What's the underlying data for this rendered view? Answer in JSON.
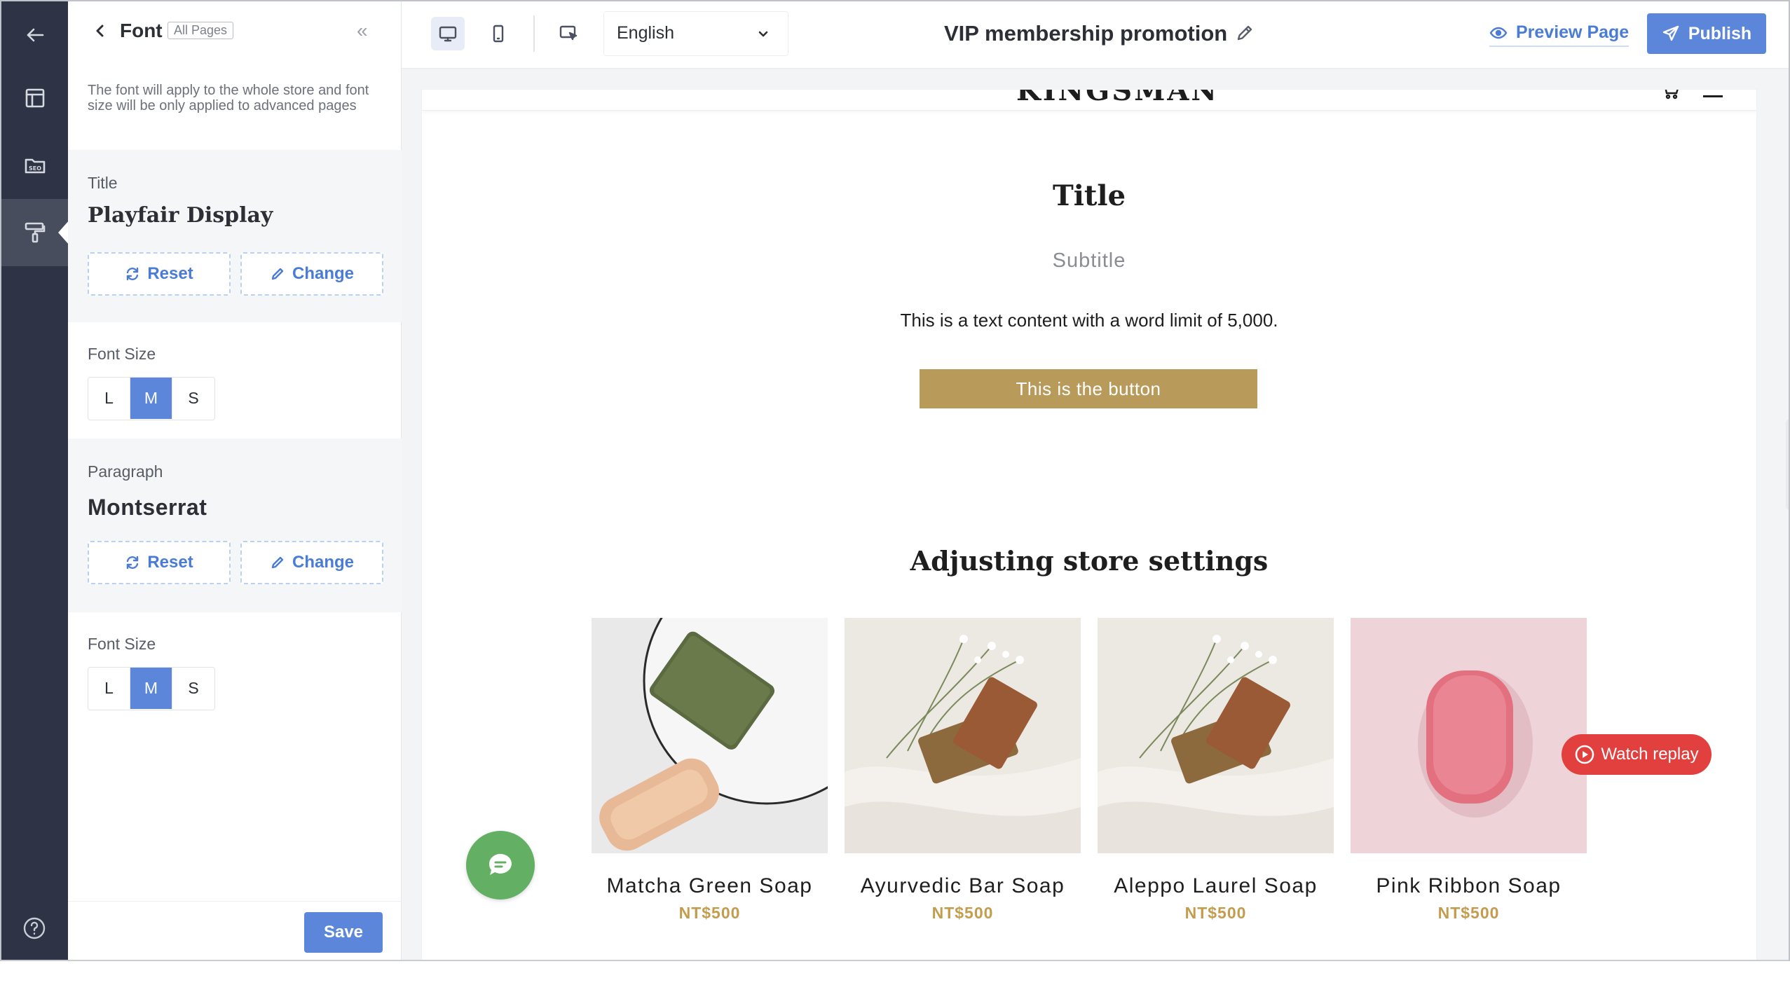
{
  "rail": {
    "items": [
      {
        "icon": "arrow-left-icon"
      },
      {
        "icon": "layout-icon"
      },
      {
        "icon": "seo-icon"
      },
      {
        "icon": "paint-roller-icon"
      }
    ],
    "help_icon": "help-circle-icon"
  },
  "panel": {
    "title": "Font",
    "badge": "All Pages",
    "description": "The font will apply to the whole store and font size will be only applied to advanced pages",
    "title_section": {
      "label": "Title",
      "font": "Playfair Display",
      "reset": "Reset",
      "change": "Change"
    },
    "title_size": {
      "label": "Font Size",
      "options": [
        "L",
        "M",
        "S"
      ],
      "selected": "M"
    },
    "paragraph_section": {
      "label": "Paragraph",
      "font": "Montserrat",
      "reset": "Reset",
      "change": "Change"
    },
    "paragraph_size": {
      "label": "Font Size",
      "options": [
        "L",
        "M",
        "S"
      ],
      "selected": "M"
    },
    "save": "Save"
  },
  "toolbar": {
    "language": "English",
    "page_name": "VIP membership promotion",
    "preview": "Preview Page",
    "publish": "Publish"
  },
  "preview": {
    "logo": "KINGSMAN",
    "title": "Title",
    "subtitle": "Subtitle",
    "text": "This is a text content with a word limit of 5,000.",
    "button": "This is the button",
    "heading": "Adjusting store settings",
    "products": [
      {
        "name": "Matcha Green Soap",
        "price": "NT$500"
      },
      {
        "name": "Ayurvedic Bar Soap",
        "price": "NT$500"
      },
      {
        "name": "Aleppo Laurel Soap",
        "price": "NT$500"
      },
      {
        "name": "Pink Ribbon Soap",
        "price": "NT$500"
      }
    ],
    "watch_replay": "Watch replay"
  },
  "colors": {
    "accent": "#5b86d9",
    "gold": "#b89a5a",
    "price": "#c39c4e",
    "rail": "#2e3445",
    "chat": "#63b064",
    "replay": "#e2403f"
  }
}
